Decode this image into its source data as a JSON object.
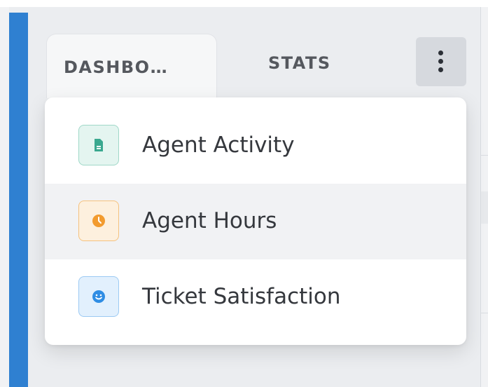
{
  "tabs": {
    "dashboards_label": "DASHBO…",
    "stats_label": "STATS"
  },
  "more_menu": {
    "icon": "kebab-vertical-icon",
    "items": [
      {
        "label": "Agent Activity",
        "icon": "document-icon",
        "icon_color": "#3aa88f",
        "icon_bg": "#e4f5f0",
        "icon_border": "#9fd8c8",
        "highlighted": false
      },
      {
        "label": "Agent Hours",
        "icon": "clock-icon",
        "icon_color": "#f29b2f",
        "icon_bg": "#fdf0de",
        "icon_border": "#f5c27e",
        "highlighted": true
      },
      {
        "label": "Ticket Satisfaction",
        "icon": "smiley-icon",
        "icon_color": "#2f8de4",
        "icon_bg": "#e2f0fd",
        "icon_border": "#9ccaf3",
        "highlighted": false
      }
    ]
  },
  "colors": {
    "accent_bar": "#2f80d1",
    "tab_text": "#55585e",
    "menu_text": "#35383d"
  }
}
